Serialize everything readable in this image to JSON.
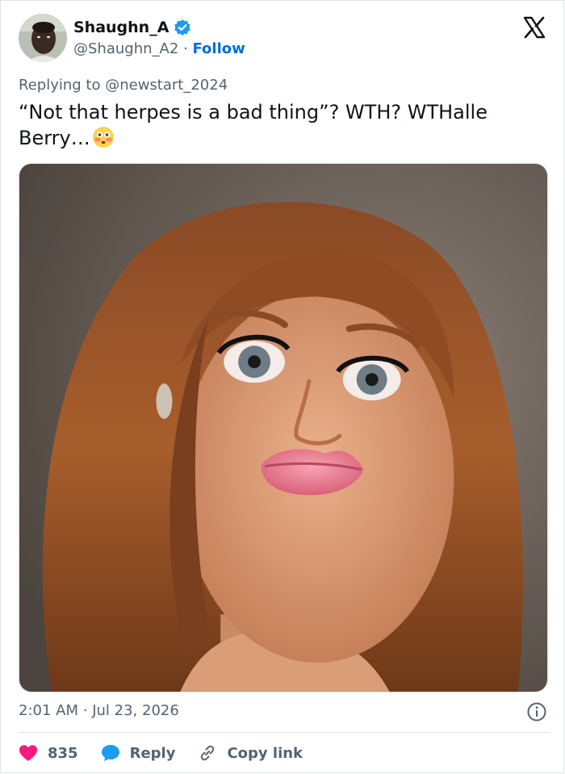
{
  "author": {
    "display_name": "Shaughn_A",
    "handle": "@Shaughn_A2",
    "separator": "·",
    "follow_label": "Follow"
  },
  "reply_context": {
    "prefix": "Replying to",
    "mention": "@newstart_2024"
  },
  "tweet": {
    "text": "“Not that herpes is a bad thing”? WTH? WTHalle Berry…",
    "emoji_icon": "flushed-face-emoji"
  },
  "timestamp": {
    "time": "2:01 AM",
    "separator": "·",
    "date": "Jul 23, 2026"
  },
  "actions": {
    "like_count": "835",
    "reply_label": "Reply",
    "copy_label": "Copy link"
  },
  "colors": {
    "follow_blue": "#006fd6",
    "like_red": "#f91880",
    "reply_blue": "#1d9bf0",
    "secondary_text": "#536471",
    "verified_blue": "#1d9bf0"
  }
}
